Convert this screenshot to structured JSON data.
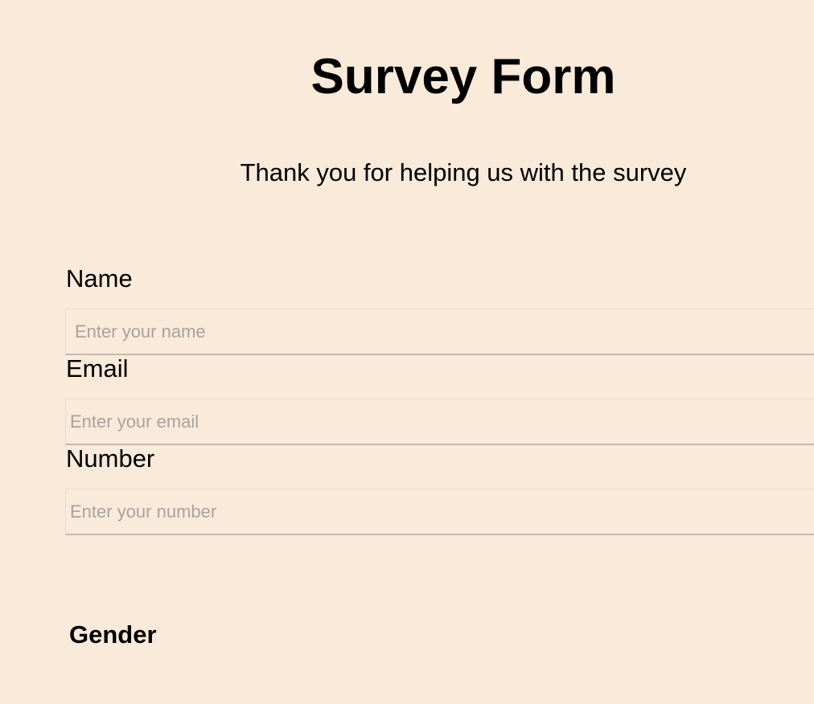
{
  "header": {
    "title": "Survey Form",
    "subtitle": "Thank you for helping us with the survey"
  },
  "form": {
    "name": {
      "label": "Name",
      "placeholder": "Enter your name",
      "value": ""
    },
    "email": {
      "label": "Email",
      "placeholder": "Enter your email",
      "value": ""
    },
    "number": {
      "label": "Number",
      "placeholder": "Enter your number",
      "value": ""
    },
    "gender": {
      "heading": "Gender"
    }
  },
  "colors": {
    "background": "#faeada",
    "text": "#000000",
    "placeholder": "#a8a39e",
    "input_underline": "#c3bab2"
  }
}
